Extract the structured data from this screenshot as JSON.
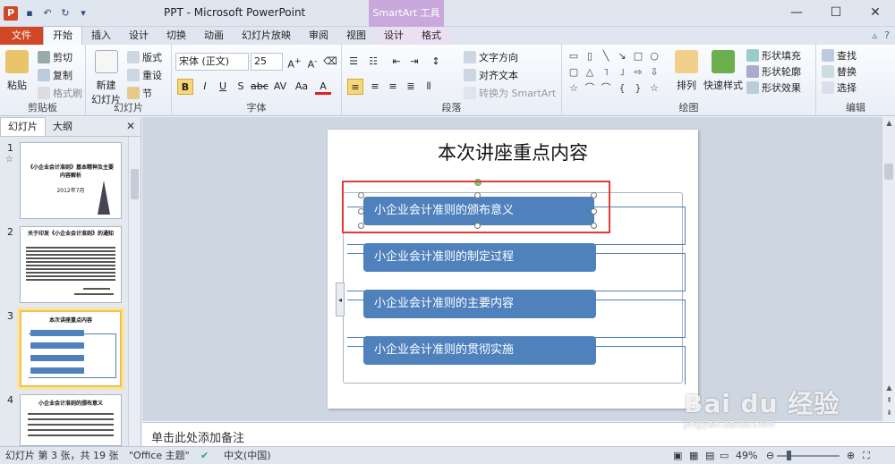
{
  "window": {
    "title": "PPT - Microsoft PowerPoint",
    "context_header": "SmartArt 工具",
    "app_icon_letter": "P",
    "controls": [
      "—",
      "☐",
      "✕"
    ]
  },
  "tabs": {
    "file": "文件",
    "items": [
      "开始",
      "插入",
      "设计",
      "切换",
      "动画",
      "幻灯片放映",
      "审阅",
      "视图"
    ],
    "context_items": [
      "设计",
      "格式"
    ]
  },
  "ribbon": {
    "clipboard": {
      "label": "剪贴板",
      "paste": "粘贴",
      "cut": "剪切",
      "copy": "复制",
      "format_painter": "格式刷"
    },
    "slides": {
      "label": "幻灯片",
      "new_slide": "新建\n幻灯片",
      "layout": "版式",
      "reset": "重设",
      "section": "节"
    },
    "font": {
      "label": "字体",
      "font_name": "宋体 (正文)",
      "font_size": "25",
      "bold": "B",
      "italic": "I",
      "underline": "U",
      "shadow": "S",
      "strike": "abc",
      "spacing": "AV",
      "case": "Aa",
      "color": "A"
    },
    "paragraph": {
      "label": "段落",
      "text_direction": "文字方向",
      "align_text": "对齐文本",
      "convert_smartart": "转换为 SmartArt"
    },
    "drawing": {
      "label": "绘图",
      "arrange": "排列",
      "quick_styles": "快速样式",
      "shape_fill": "形状填充",
      "shape_outline": "形状轮廓",
      "shape_effects": "形状效果"
    },
    "editing": {
      "label": "编辑",
      "find": "查找",
      "replace": "替换",
      "select": "选择"
    }
  },
  "left_panel": {
    "tabs": [
      "幻灯片",
      "大纲"
    ],
    "thumbs": [
      {
        "num": "1",
        "title": "《小企业会计准则》基本精神及主要内容解析",
        "sub": "2012年7月"
      },
      {
        "num": "2",
        "title": "关于印发《小企业会计准则》的通知"
      },
      {
        "num": "3",
        "title": "本次讲座重点内容"
      },
      {
        "num": "4",
        "title": "小企业会计准则的颁布意义"
      }
    ]
  },
  "slide": {
    "title": "本次讲座重点内容",
    "items": [
      "小企业会计准则的颁布意义",
      "小企业会计准则的制定过程",
      "小企业会计准则的主要内容",
      "小企业会计准则的贯彻实施"
    ],
    "smartart_color": "#4f81bd"
  },
  "notes": {
    "placeholder": "单击此处添加备注"
  },
  "status": {
    "slide_info": "幻灯片 第 3 张，共 19 张",
    "theme": "\"Office 主题\"",
    "language": "中文(中国)",
    "zoom": "49%"
  },
  "watermark": {
    "logo": "Bai du 经验",
    "url": "jingyan.baidu.com"
  },
  "colors": {
    "file_tab": "#d24726",
    "context": "#c9a8dc",
    "selection_frame": "#e23c3c"
  }
}
